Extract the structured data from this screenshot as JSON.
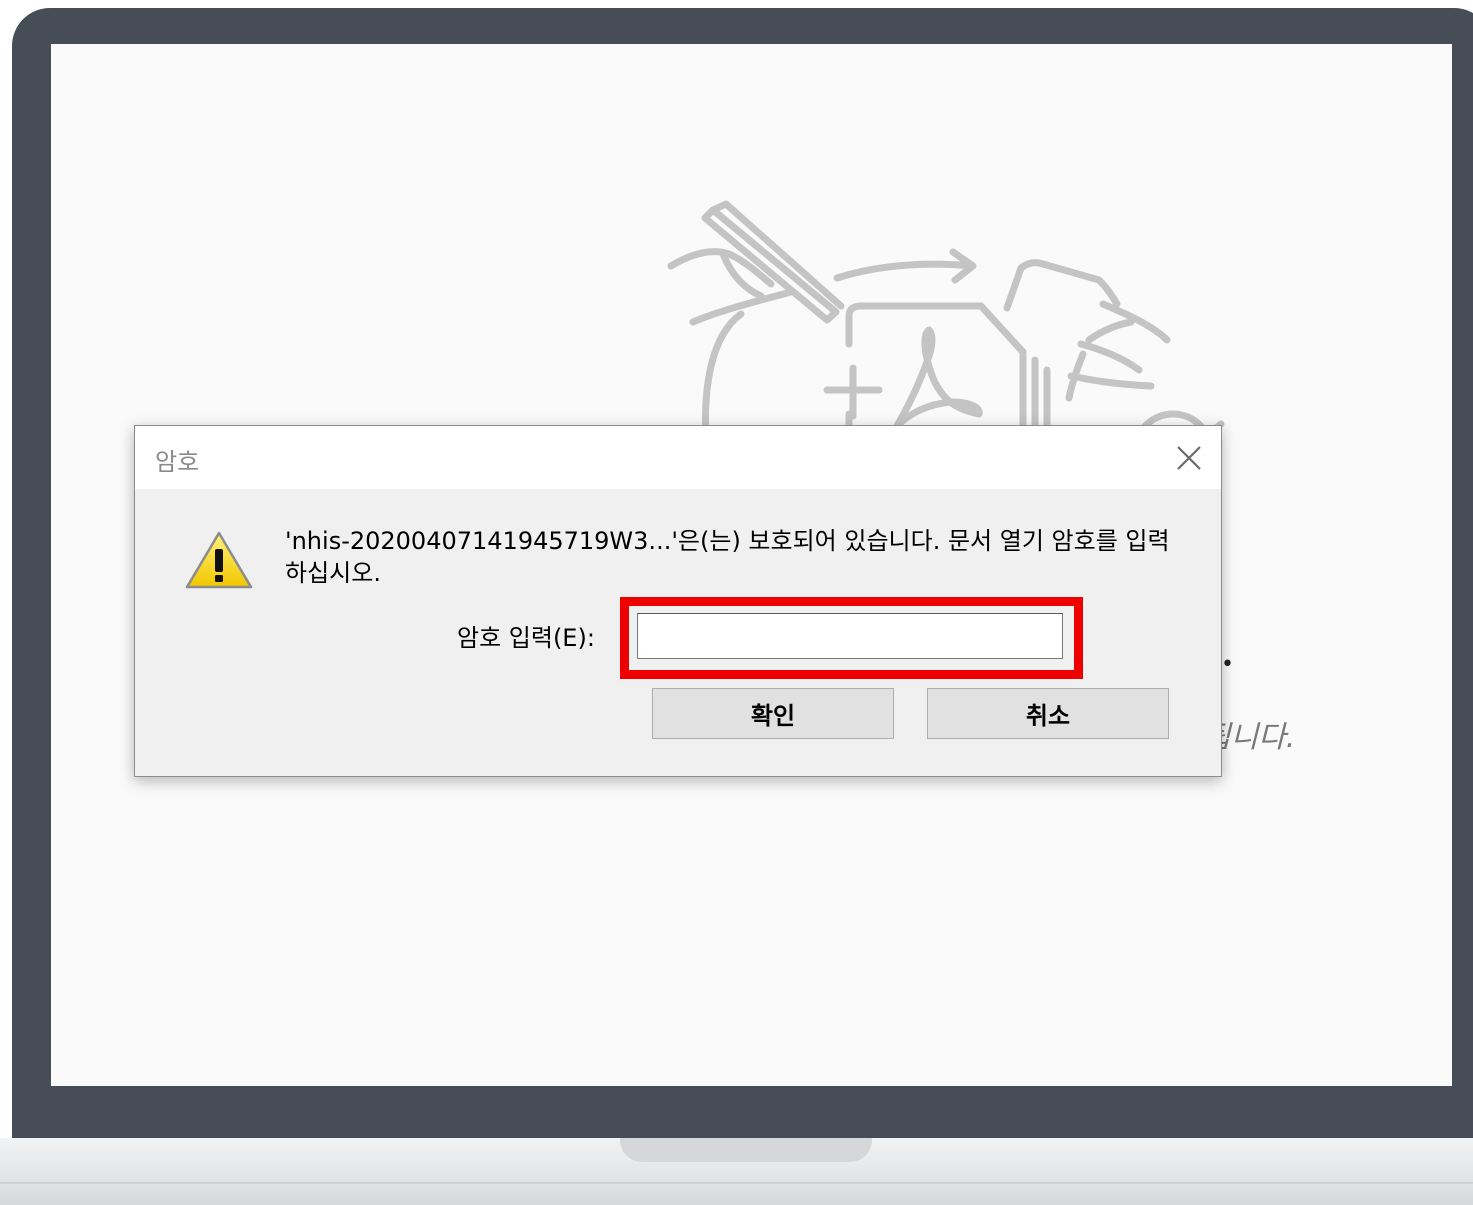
{
  "dialog": {
    "title": "암호",
    "message": "'nhis-20200407141945719W3...'은(는) 보호되어 있습니다. 문서 열기 암호를 입력하십시오.",
    "password_label": "암호 입력(E):",
    "password_value": "",
    "ok_label": "확인",
    "cancel_label": "취소",
    "close_icon": "close-icon",
    "warning_icon": "warning-icon"
  },
  "background": {
    "dot_text": "•",
    "partial_text": "됩니다."
  },
  "colors": {
    "laptop_frame": "#464d57",
    "screen_bg": "#fafafa",
    "dialog_bg": "#f0f0f0",
    "highlight": "#ee0000",
    "warning_yellow": "#f7d000"
  }
}
